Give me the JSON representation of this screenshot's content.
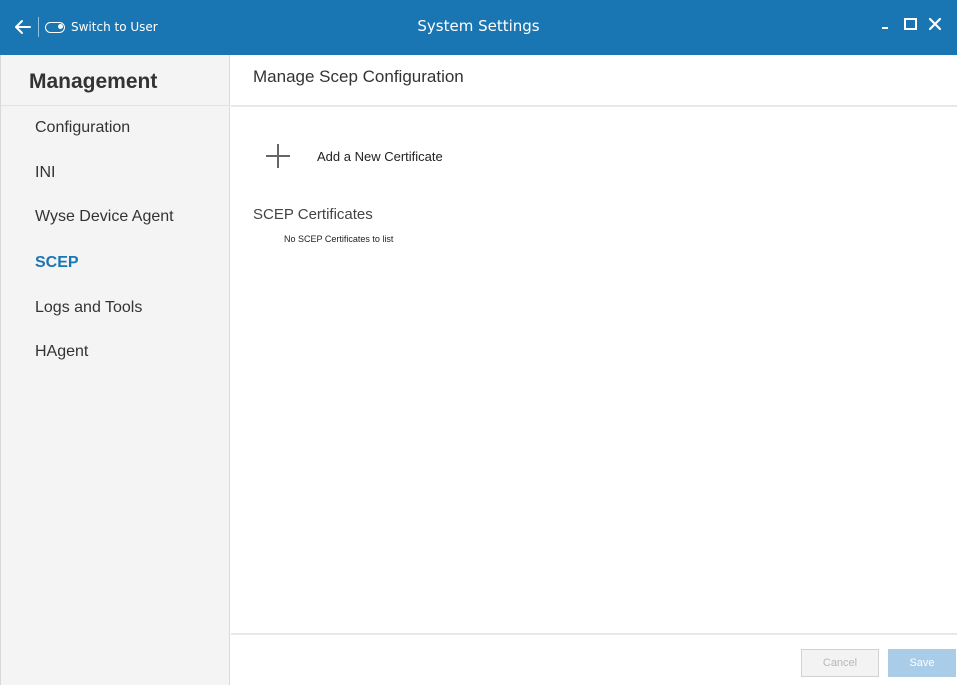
{
  "titlebar": {
    "back_icon": "arrow-left-icon",
    "switch_user_icon": "toggle-switch-icon",
    "switch_user_label": "Switch to User",
    "title": "System Settings",
    "controls": [
      "minimize-icon",
      "maximize-icon",
      "close-icon"
    ]
  },
  "sidebar": {
    "title": "Management",
    "items": [
      {
        "label": "Configuration"
      },
      {
        "label": "INI"
      },
      {
        "label": "Wyse Device Agent"
      },
      {
        "label": "SCEP",
        "active": true
      },
      {
        "label": "Logs and Tools"
      },
      {
        "label": "HAgent"
      }
    ]
  },
  "main": {
    "page_title": "Manage Scep Configuration",
    "add_icon": "plus-icon",
    "add_label": "Add a New Certificate",
    "section_title": "SCEP Certificates",
    "empty_message": "No SCEP Certificates to list"
  },
  "footer": {
    "cancel_label": "Cancel",
    "save_label": "Save"
  },
  "colors": {
    "titlebar": "#1a76b3",
    "accent": "#1a76b3",
    "sidebar_bg": "#f4f4f4",
    "save_disabled": "#a9cde8"
  }
}
